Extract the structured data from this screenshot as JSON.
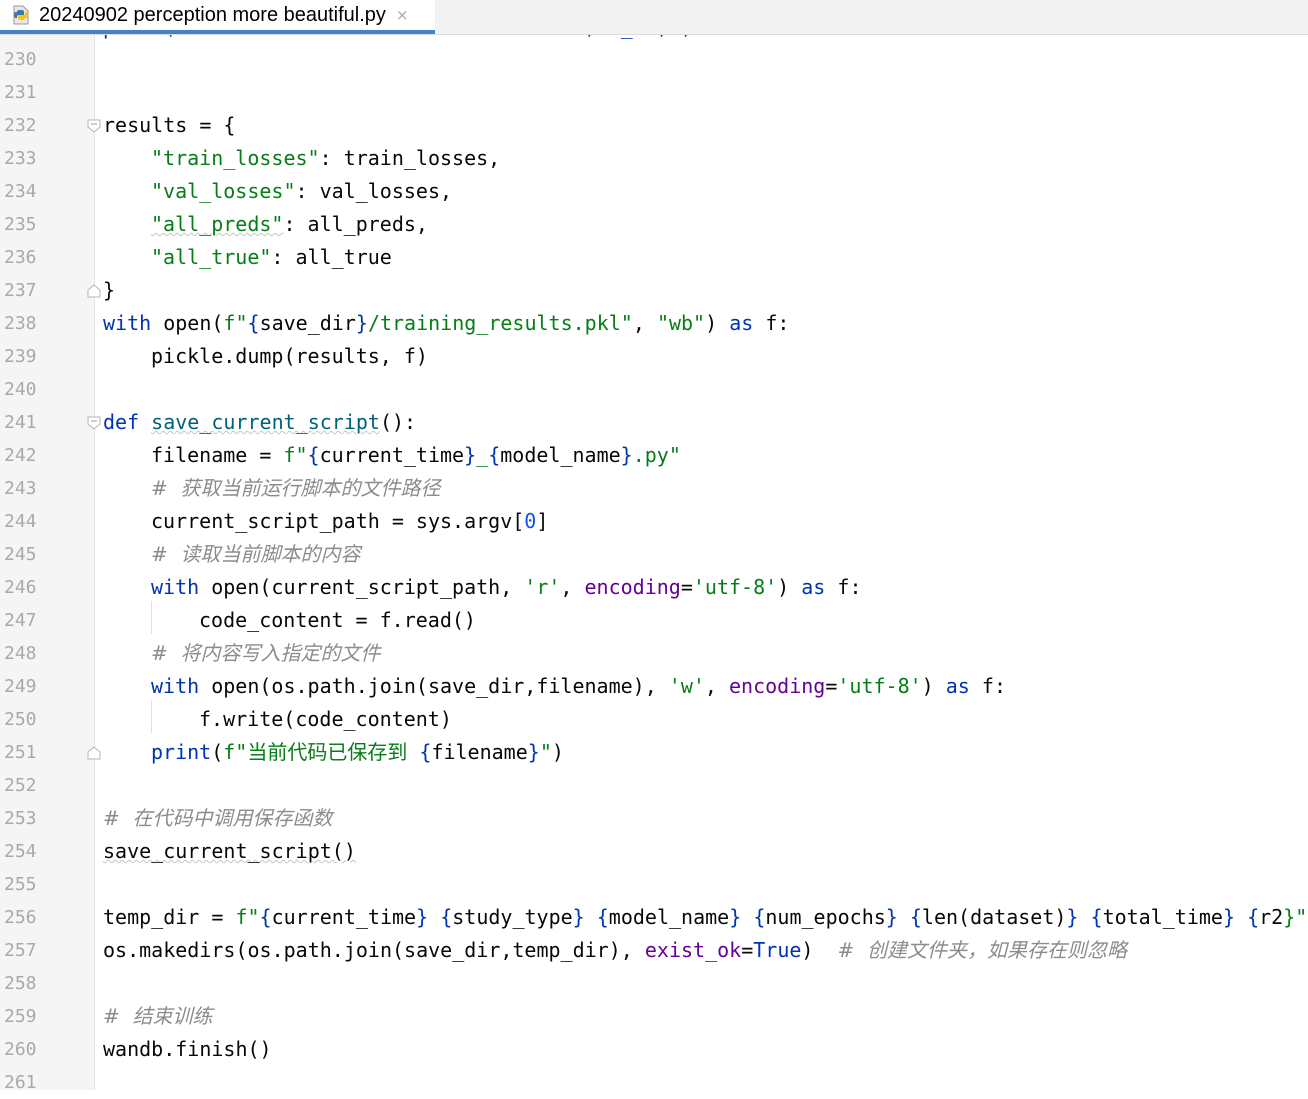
{
  "tab": {
    "title": "20240902 perception more beautiful.py",
    "close_glyph": "×",
    "icon": "python-file-icon"
  },
  "colors": {
    "keyword": "#0033b3",
    "string": "#067d17",
    "number": "#1750eb",
    "parameter": "#660099",
    "comment": "#8c8c8c",
    "accent": "#4083c9"
  },
  "gutter": {
    "line_numbers": [
      "230",
      "231",
      "232",
      "233",
      "234",
      "235",
      "236",
      "237",
      "238",
      "239",
      "240",
      "241",
      "242",
      "243",
      "244",
      "245",
      "246",
      "247",
      "248",
      "249",
      "250",
      "251",
      "252",
      "253",
      "254",
      "255",
      "256",
      "257",
      "258",
      "259",
      "260",
      "261"
    ]
  },
  "code": {
    "l232": {
      "a": "results = {"
    },
    "l233": {
      "a": "\"train_losses\"",
      "b": ": train_losses,"
    },
    "l234": {
      "a": "\"val_losses\"",
      "b": ": val_losses,"
    },
    "l235": {
      "a": "\"all_preds\"",
      "b": ": all_preds,"
    },
    "l236": {
      "a": "\"all_true\"",
      "b": ": all_true"
    },
    "l237": {
      "a": "}"
    },
    "l238": {
      "a": "with",
      "b": " open(",
      "c": "f\"",
      "d": "{",
      "e": "save_dir",
      "f": "}",
      "g": "/training_results.pkl\"",
      "h": ", ",
      "i": "\"wb\"",
      "j": ") ",
      "k": "as",
      "l": " f:"
    },
    "l239": {
      "a": "pickle.dump(results, f)"
    },
    "l241": {
      "a": "def",
      "b": " ",
      "c": "save_current_script",
      "d": "():"
    },
    "l242": {
      "a": "filename = ",
      "b": "f\"",
      "c": "{",
      "d": "current_time",
      "e": "}",
      "f": "_",
      "g": "{",
      "h": "model_name",
      "i": "}",
      "j": ".py\""
    },
    "l243": {
      "a": "#  获取当前运行脚本的文件路径"
    },
    "l244": {
      "a": "current_script_path = sys.argv[",
      "b": "0",
      "c": "]"
    },
    "l245": {
      "a": "#  读取当前脚本的内容"
    },
    "l246": {
      "a": "with",
      "b": " open(current_script_path, ",
      "c": "'r'",
      "d": ", ",
      "e": "encoding",
      "f": "=",
      "g": "'utf-8'",
      "h": ") ",
      "i": "as",
      "j": " f:"
    },
    "l247": {
      "a": "code_content = f.read()"
    },
    "l248": {
      "a": "#  将内容写入指定的文件"
    },
    "l249": {
      "a": "with",
      "b": " open(os.path.join(save_dir,filename), ",
      "c": "'w'",
      "d": ", ",
      "e": "encoding",
      "f": "=",
      "g": "'utf-8'",
      "h": ") ",
      "i": "as",
      "j": " f:"
    },
    "l250": {
      "a": "f.write(code_content)"
    },
    "l251": {
      "a": "print",
      "b": "(",
      "c": "f\"当前代码已保存到 ",
      "d": "{",
      "e": "filename",
      "f": "}",
      "g": "\"",
      "h": ")"
    },
    "l253": {
      "a": "#  在代码中调用保存函数"
    },
    "l254": {
      "a": "save_current_script()"
    },
    "l256": {
      "a": "temp_dir = ",
      "b": "f\"",
      "c": "{",
      "d": "current_time",
      "e": "}",
      "f": " ",
      "g": "{",
      "h": "study_type",
      "i": "}",
      "j": " ",
      "k": "{",
      "l": "model_name",
      "m": "}",
      "n": " ",
      "o": "{",
      "p": "num_epochs",
      "q": "}",
      "r": " ",
      "s": "{",
      "t": "len(dataset)",
      "u": "}",
      "v": " ",
      "w": "{",
      "x": "total_time",
      "y": "}",
      "z": " ",
      "aa": "{",
      "ab": "r2",
      "ac": "}\""
    },
    "l257": {
      "a": "os.makedirs(os.path.join(save_dir,temp_dir), ",
      "b": "exist_ok",
      "c": "=",
      "d": "True",
      "e": ")  ",
      "f": "#  创建文件夹，如果存在则忽略"
    },
    "l259": {
      "a": "#  结束训练"
    },
    "l260": {
      "a": "wandb.finish()"
    }
  }
}
